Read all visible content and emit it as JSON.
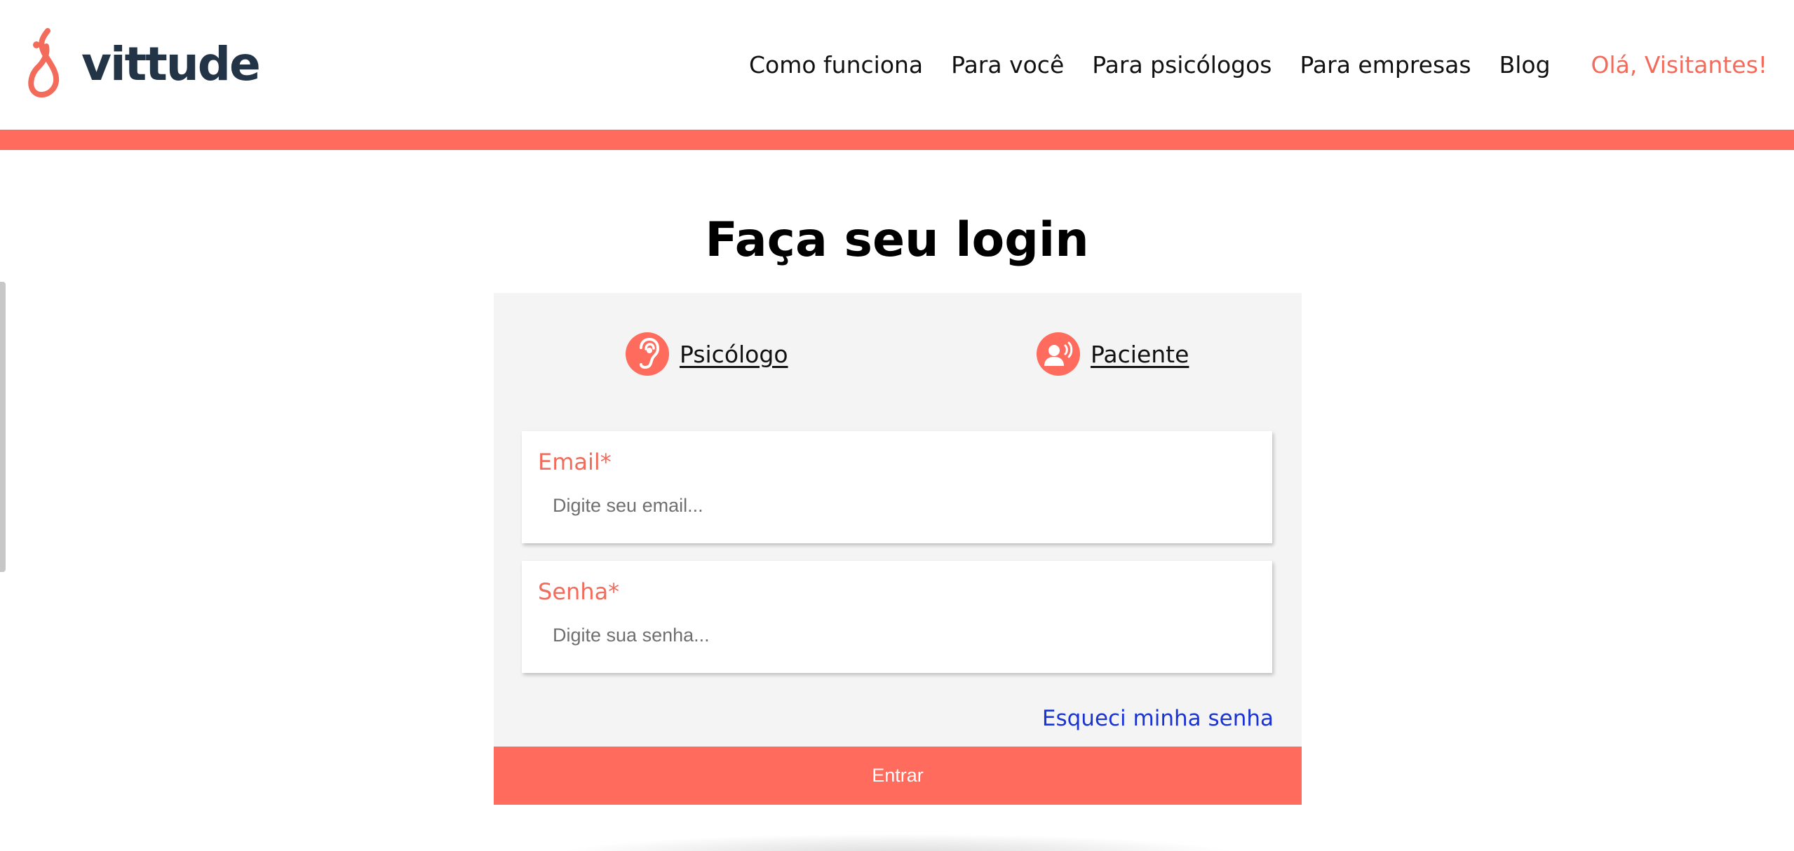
{
  "brand": {
    "name": "vittude",
    "logo_icon": "vittude-figure-logo",
    "primary_color": "#ff6b5d",
    "text_color": "#243447"
  },
  "nav": {
    "items": [
      {
        "label": "Como funciona"
      },
      {
        "label": "Para você"
      },
      {
        "label": "Para psicólogos"
      },
      {
        "label": "Para empresas"
      },
      {
        "label": "Blog"
      }
    ],
    "greeting": "Olá, Visitantes!"
  },
  "login": {
    "title": "Faça seu login",
    "roles": [
      {
        "label": "Psicólogo",
        "icon": "ear-icon"
      },
      {
        "label": "Paciente",
        "icon": "person-speaking-icon"
      }
    ],
    "email": {
      "label": "Email*",
      "placeholder": "Digite seu email..."
    },
    "password": {
      "label": "Senha*",
      "placeholder": "Digite sua senha..."
    },
    "forgot_label": "Esqueci minha senha",
    "submit_label": "Entrar",
    "link_color": "#1a33d4",
    "card_background": "#f4f4f4"
  }
}
